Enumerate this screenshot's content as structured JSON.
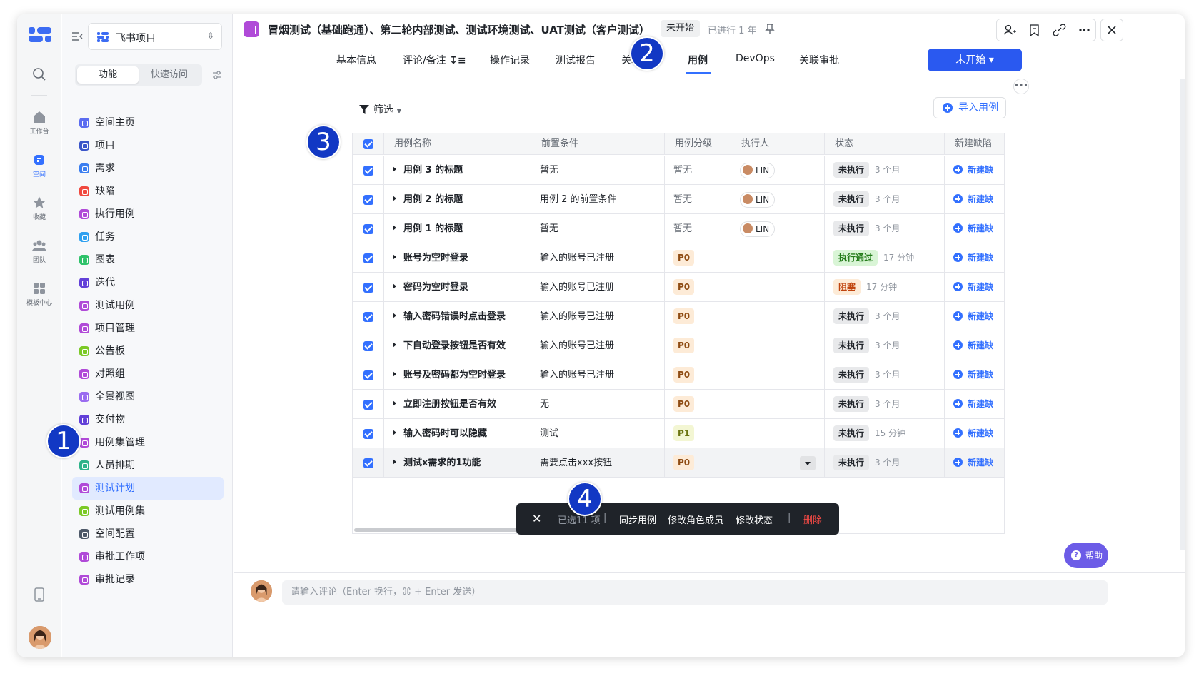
{
  "rail": {
    "items": [
      {
        "label": "工作台",
        "icon": "home-icon"
      },
      {
        "label": "空间",
        "icon": "space-icon"
      },
      {
        "label": "收藏",
        "icon": "star-icon"
      },
      {
        "label": "团队",
        "icon": "team-icon"
      },
      {
        "label": "模板中心",
        "icon": "template-icon"
      }
    ]
  },
  "panel": {
    "project": "飞书项目",
    "seg": {
      "features": "功能",
      "quick": "快速访问"
    },
    "nav": [
      {
        "label": "空间主页",
        "color": "#5b6cf0"
      },
      {
        "label": "项目",
        "color": "#3b56c9"
      },
      {
        "label": "需求",
        "color": "#3b7ef0"
      },
      {
        "label": "缺陷",
        "color": "#f0483e"
      },
      {
        "label": "执行用例",
        "color": "#b04ad8"
      },
      {
        "label": "任务",
        "color": "#2ea0f0"
      },
      {
        "label": "图表",
        "color": "#2ec26a"
      },
      {
        "label": "迭代",
        "color": "#6240d8"
      },
      {
        "label": "测试用例",
        "color": "#b04ad8"
      },
      {
        "label": "项目管理",
        "color": "#b04ad8"
      },
      {
        "label": "公告板",
        "color": "#7bc926"
      },
      {
        "label": "对照组",
        "color": "#b04ad8"
      },
      {
        "label": "全景视图",
        "color": "#9a6cf0"
      },
      {
        "label": "交付物",
        "color": "#6240d8"
      },
      {
        "label": "用例集管理",
        "color": "#b04ad8"
      },
      {
        "label": "人员排期",
        "color": "#2eb38a"
      },
      {
        "label": "测试计划",
        "color": "#b04ad8"
      },
      {
        "label": "测试用例集",
        "color": "#7bc926"
      },
      {
        "label": "空间配置",
        "color": "#4e5969"
      },
      {
        "label": "审批工作项",
        "color": "#b04ad8"
      },
      {
        "label": "审批记录",
        "color": "#b04ad8"
      }
    ]
  },
  "header": {
    "title": "冒烟测试（基础跑通）、第二轮内部测试、测试环境测试、UAT测试（客户测试）",
    "status": "未开始",
    "since": "已进行 1 年"
  },
  "tabs": [
    "基本信息",
    "评论/备注",
    "操作记录",
    "测试报告",
    "关联用",
    "用例",
    "DevOps",
    "关联审批"
  ],
  "start_button": "未开始 ▾",
  "filter_label": "筛选",
  "import_button": "导入用例",
  "table": {
    "columns": [
      "用例名称",
      "前置条件",
      "用例分级",
      "执行人",
      "状态",
      "新建缺陷"
    ],
    "new_defect": "新建缺",
    "rows": [
      {
        "name": "用例 3 的标题",
        "pre": "暂无",
        "level": "暂无",
        "user": "LIN",
        "status": "未执行",
        "ago": "3 个月"
      },
      {
        "name": "用例 2 的标题",
        "pre": "用例 2 的前置条件",
        "level": "暂无",
        "user": "LIN",
        "status": "未执行",
        "ago": "3 个月"
      },
      {
        "name": "用例 1 的标题",
        "pre": "暂无",
        "level": "暂无",
        "user": "LIN",
        "status": "未执行",
        "ago": "3 个月"
      },
      {
        "name": "账号为空时登录",
        "pre": "输入的账号已注册",
        "level": "P0",
        "user": "",
        "status": "执行通过",
        "ago": "17 分钟"
      },
      {
        "name": "密码为空时登录",
        "pre": "输入的账号已注册",
        "level": "P0",
        "user": "",
        "status": "阻塞",
        "ago": "17 分钟"
      },
      {
        "name": "输入密码错误时点击登录",
        "pre": "输入的账号已注册",
        "level": "P0",
        "user": "",
        "status": "未执行",
        "ago": "3 个月"
      },
      {
        "name": "下自动登录按钮是否有效",
        "pre": "输入的账号已注册",
        "level": "P0",
        "user": "",
        "status": "未执行",
        "ago": "3 个月"
      },
      {
        "name": "账号及密码都为空时登录",
        "pre": "输入的账号已注册",
        "level": "P0",
        "user": "",
        "status": "未执行",
        "ago": "3 个月"
      },
      {
        "name": "立即注册按钮是否有效",
        "pre": "无",
        "level": "P0",
        "user": "",
        "status": "未执行",
        "ago": "3 个月"
      },
      {
        "name": "输入密码时可以隐藏",
        "pre": "测试",
        "level": "P1",
        "user": "",
        "status": "未执行",
        "ago": "15 分钟"
      },
      {
        "name": "测试x需求的1功能",
        "pre": "需要点击xxx按钮",
        "level": "P0",
        "user": "",
        "status": "未执行",
        "ago": "3 个月"
      }
    ]
  },
  "action_bar": {
    "count": "已选11 项",
    "sep": "|",
    "sync": "同步用例",
    "roles": "修改角色成员",
    "status": "修改状态",
    "delete": "删除"
  },
  "comment_placeholder": "请输入评论（Enter 换行，⌘ + Enter 发送）",
  "help": "帮助",
  "markers": [
    "1",
    "2",
    "3",
    "4"
  ]
}
